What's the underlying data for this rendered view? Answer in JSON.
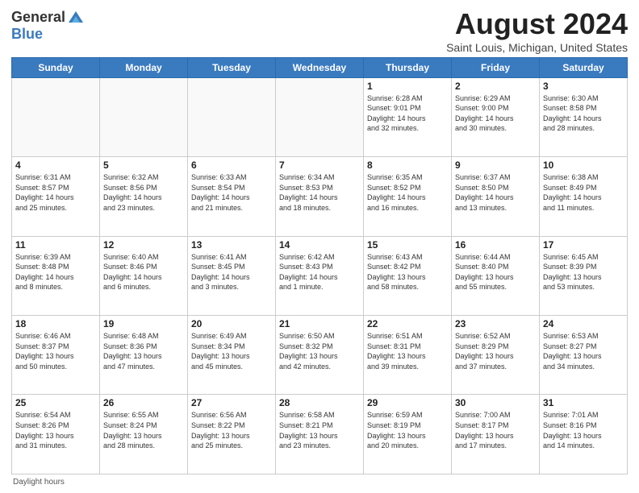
{
  "header": {
    "logo_general": "General",
    "logo_blue": "Blue",
    "title": "August 2024",
    "subtitle": "Saint Louis, Michigan, United States"
  },
  "days_of_week": [
    "Sunday",
    "Monday",
    "Tuesday",
    "Wednesday",
    "Thursday",
    "Friday",
    "Saturday"
  ],
  "footer": {
    "note": "Daylight hours"
  },
  "weeks": [
    [
      {
        "day": "",
        "info": ""
      },
      {
        "day": "",
        "info": ""
      },
      {
        "day": "",
        "info": ""
      },
      {
        "day": "",
        "info": ""
      },
      {
        "day": "1",
        "info": "Sunrise: 6:28 AM\nSunset: 9:01 PM\nDaylight: 14 hours\nand 32 minutes."
      },
      {
        "day": "2",
        "info": "Sunrise: 6:29 AM\nSunset: 9:00 PM\nDaylight: 14 hours\nand 30 minutes."
      },
      {
        "day": "3",
        "info": "Sunrise: 6:30 AM\nSunset: 8:58 PM\nDaylight: 14 hours\nand 28 minutes."
      }
    ],
    [
      {
        "day": "4",
        "info": "Sunrise: 6:31 AM\nSunset: 8:57 PM\nDaylight: 14 hours\nand 25 minutes."
      },
      {
        "day": "5",
        "info": "Sunrise: 6:32 AM\nSunset: 8:56 PM\nDaylight: 14 hours\nand 23 minutes."
      },
      {
        "day": "6",
        "info": "Sunrise: 6:33 AM\nSunset: 8:54 PM\nDaylight: 14 hours\nand 21 minutes."
      },
      {
        "day": "7",
        "info": "Sunrise: 6:34 AM\nSunset: 8:53 PM\nDaylight: 14 hours\nand 18 minutes."
      },
      {
        "day": "8",
        "info": "Sunrise: 6:35 AM\nSunset: 8:52 PM\nDaylight: 14 hours\nand 16 minutes."
      },
      {
        "day": "9",
        "info": "Sunrise: 6:37 AM\nSunset: 8:50 PM\nDaylight: 14 hours\nand 13 minutes."
      },
      {
        "day": "10",
        "info": "Sunrise: 6:38 AM\nSunset: 8:49 PM\nDaylight: 14 hours\nand 11 minutes."
      }
    ],
    [
      {
        "day": "11",
        "info": "Sunrise: 6:39 AM\nSunset: 8:48 PM\nDaylight: 14 hours\nand 8 minutes."
      },
      {
        "day": "12",
        "info": "Sunrise: 6:40 AM\nSunset: 8:46 PM\nDaylight: 14 hours\nand 6 minutes."
      },
      {
        "day": "13",
        "info": "Sunrise: 6:41 AM\nSunset: 8:45 PM\nDaylight: 14 hours\nand 3 minutes."
      },
      {
        "day": "14",
        "info": "Sunrise: 6:42 AM\nSunset: 8:43 PM\nDaylight: 14 hours\nand 1 minute."
      },
      {
        "day": "15",
        "info": "Sunrise: 6:43 AM\nSunset: 8:42 PM\nDaylight: 13 hours\nand 58 minutes."
      },
      {
        "day": "16",
        "info": "Sunrise: 6:44 AM\nSunset: 8:40 PM\nDaylight: 13 hours\nand 55 minutes."
      },
      {
        "day": "17",
        "info": "Sunrise: 6:45 AM\nSunset: 8:39 PM\nDaylight: 13 hours\nand 53 minutes."
      }
    ],
    [
      {
        "day": "18",
        "info": "Sunrise: 6:46 AM\nSunset: 8:37 PM\nDaylight: 13 hours\nand 50 minutes."
      },
      {
        "day": "19",
        "info": "Sunrise: 6:48 AM\nSunset: 8:36 PM\nDaylight: 13 hours\nand 47 minutes."
      },
      {
        "day": "20",
        "info": "Sunrise: 6:49 AM\nSunset: 8:34 PM\nDaylight: 13 hours\nand 45 minutes."
      },
      {
        "day": "21",
        "info": "Sunrise: 6:50 AM\nSunset: 8:32 PM\nDaylight: 13 hours\nand 42 minutes."
      },
      {
        "day": "22",
        "info": "Sunrise: 6:51 AM\nSunset: 8:31 PM\nDaylight: 13 hours\nand 39 minutes."
      },
      {
        "day": "23",
        "info": "Sunrise: 6:52 AM\nSunset: 8:29 PM\nDaylight: 13 hours\nand 37 minutes."
      },
      {
        "day": "24",
        "info": "Sunrise: 6:53 AM\nSunset: 8:27 PM\nDaylight: 13 hours\nand 34 minutes."
      }
    ],
    [
      {
        "day": "25",
        "info": "Sunrise: 6:54 AM\nSunset: 8:26 PM\nDaylight: 13 hours\nand 31 minutes."
      },
      {
        "day": "26",
        "info": "Sunrise: 6:55 AM\nSunset: 8:24 PM\nDaylight: 13 hours\nand 28 minutes."
      },
      {
        "day": "27",
        "info": "Sunrise: 6:56 AM\nSunset: 8:22 PM\nDaylight: 13 hours\nand 25 minutes."
      },
      {
        "day": "28",
        "info": "Sunrise: 6:58 AM\nSunset: 8:21 PM\nDaylight: 13 hours\nand 23 minutes."
      },
      {
        "day": "29",
        "info": "Sunrise: 6:59 AM\nSunset: 8:19 PM\nDaylight: 13 hours\nand 20 minutes."
      },
      {
        "day": "30",
        "info": "Sunrise: 7:00 AM\nSunset: 8:17 PM\nDaylight: 13 hours\nand 17 minutes."
      },
      {
        "day": "31",
        "info": "Sunrise: 7:01 AM\nSunset: 8:16 PM\nDaylight: 13 hours\nand 14 minutes."
      }
    ]
  ]
}
